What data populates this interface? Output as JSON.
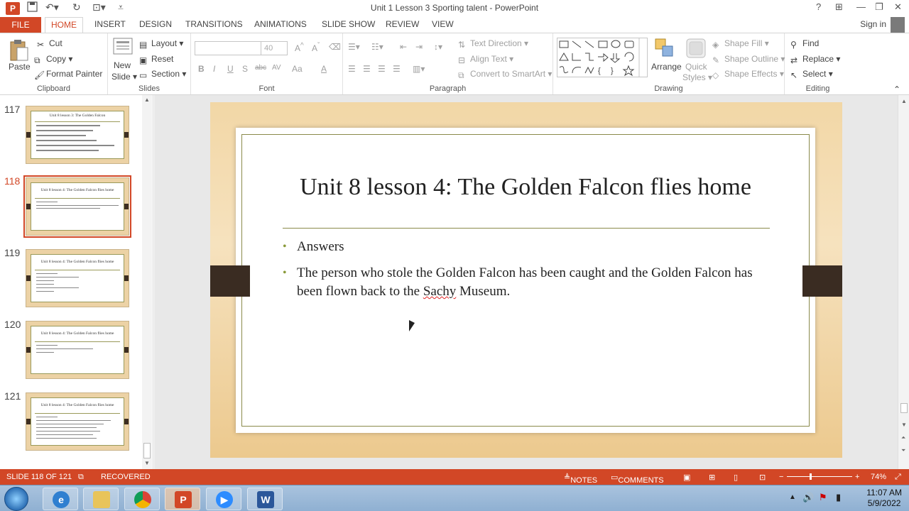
{
  "window": {
    "title": "Unit 1 Lesson 3 Sporting talent - PowerPoint",
    "help": "?",
    "minimize": "—",
    "restore": "❐",
    "close": "✕"
  },
  "tabs": [
    {
      "label": "FILE"
    },
    {
      "label": "HOME"
    },
    {
      "label": "INSERT"
    },
    {
      "label": "DESIGN"
    },
    {
      "label": "TRANSITIONS"
    },
    {
      "label": "ANIMATIONS"
    },
    {
      "label": "SLIDE SHOW"
    },
    {
      "label": "REVIEW"
    },
    {
      "label": "VIEW"
    }
  ],
  "signin": "Sign in",
  "ribbon": {
    "clipboard": {
      "label": "Clipboard",
      "paste": "Paste",
      "cut": "Cut",
      "copy": "Copy",
      "format_painter": "Format Painter"
    },
    "slides": {
      "label": "Slides",
      "new_slide_1": "New",
      "new_slide_2": "Slide",
      "layout": "Layout",
      "reset": "Reset",
      "section": "Section"
    },
    "font": {
      "label": "Font",
      "font_name": "",
      "font_size": "40",
      "bold": "B",
      "italic": "I",
      "underline": "U",
      "shadow": "S",
      "strike": "abc",
      "spacing": "AV",
      "case": "Aa",
      "color": "A"
    },
    "paragraph": {
      "label": "Paragraph",
      "text_direction": "Text Direction",
      "align_text": "Align Text",
      "smartart": "Convert to SmartArt"
    },
    "drawing": {
      "label": "Drawing",
      "arrange": "Arrange",
      "quick_styles_1": "Quick",
      "quick_styles_2": "Styles",
      "shape_fill": "Shape Fill",
      "shape_outline": "Shape Outline",
      "shape_effects": "Shape Effects"
    },
    "editing": {
      "label": "Editing",
      "find": "Find",
      "replace": "Replace",
      "select": "Select"
    }
  },
  "thumbnails": [
    {
      "num": "117",
      "title": "Unit 8 lesson 3: The Golden Falcon",
      "lines": 6
    },
    {
      "num": "118",
      "title": "Unit 8 lesson 4: The Golden Falcon flies home",
      "lines": 3,
      "selected": true
    },
    {
      "num": "119",
      "title": "Unit 8 lesson 4: The Golden Falcon flies home",
      "lines": 6
    },
    {
      "num": "120",
      "title": "Unit 8 lesson 4: The Golden Falcon flies home",
      "lines": 3
    },
    {
      "num": "121",
      "title": "Unit 8 lesson 4: The Golden Falcon flies home",
      "lines": 7
    }
  ],
  "slide": {
    "title": "Unit 8 lesson 4: The Golden Falcon flies home",
    "bullets": [
      {
        "text": "Answers"
      },
      {
        "text_before": "The person who stole the Golden Falcon has been caught and the Golden Falcon has been flown back to the ",
        "misspelled": "Sachy",
        "text_after": " Museum."
      }
    ]
  },
  "status": {
    "slide_counter": "SLIDE 118 OF 121",
    "recovered": "RECOVERED",
    "notes": "NOTES",
    "comments": "COMMENTS",
    "zoom": "74%"
  },
  "clock": {
    "time": "11:07 AM",
    "date": "5/9/2022"
  },
  "colors": {
    "accent": "#d24726",
    "slide_bg": "#f2d7a6",
    "bullet": "#8a9a3a"
  }
}
